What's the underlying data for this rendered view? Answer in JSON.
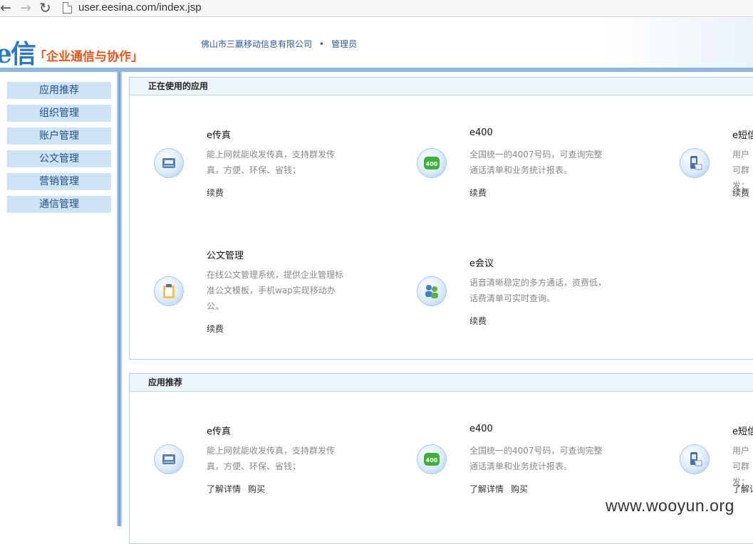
{
  "browser": {
    "back_icon": "arrow-left-icon",
    "forward_icon": "arrow-right-icon",
    "reload_icon": "reload-icon",
    "url": "user.eesina.com/index.jsp"
  },
  "header": {
    "logo_mark": "e信",
    "slogan": "「企业通信与协作」",
    "company": "佛山市三赢移动信息有限公司",
    "separator": "•",
    "role": "管理员"
  },
  "sidebar": {
    "items": [
      {
        "label": "应用推荐"
      },
      {
        "label": "组织管理"
      },
      {
        "label": "账户管理"
      },
      {
        "label": "公文管理"
      },
      {
        "label": "营销管理"
      },
      {
        "label": "通信管理"
      }
    ]
  },
  "in_use": {
    "title": "正在使用的应用",
    "apps": [
      {
        "name": "e传真",
        "icon": "fax-icon",
        "desc": "能上网就能收发传真，支持群发传真，方便、环保、省钱；",
        "link": "续费"
      },
      {
        "name": "e400",
        "icon": "badge-400-icon",
        "badge_text": "400",
        "desc": "全国统一的4007号码，可查询完整通话清单和业务统计报表。",
        "link": "续费"
      },
      {
        "name": "e短信",
        "icon": "sms-phone-icon",
        "desc": "用户可群发；",
        "link": "续费"
      },
      {
        "name": "公文管理",
        "icon": "clipboard-icon",
        "desc": "在线公文管理系统，提供企业管理标准公文模板，手机wap实现移动办公。",
        "link": "续费"
      },
      {
        "name": "e会议",
        "icon": "meeting-icon",
        "desc": "语音清晰稳定的多方通话，资费低，话费清单可实时查询。",
        "link": "续费"
      }
    ]
  },
  "recommended": {
    "title": "应用推荐",
    "apps": [
      {
        "name": "e传真",
        "icon": "fax-icon",
        "desc": "能上网就能收发传真，支持群发传真，方便、环保、省钱；",
        "details": "了解详情",
        "buy": "购买"
      },
      {
        "name": "e400",
        "icon": "badge-400-icon",
        "badge_text": "400",
        "desc": "全国统一的4007号码，可查询完整通话清单和业务统计报表。",
        "details": "了解详情",
        "buy": "购买"
      },
      {
        "name": "e短信",
        "icon": "sms-phone-icon",
        "desc": "用户可群发；",
        "details": "了解详"
      }
    ]
  },
  "watermark": "www.wooyun.org",
  "colors": {
    "brand_blue": "#2e78c2",
    "slogan_orange": "#e2561b",
    "menu_bg": "#cfe3f7",
    "badge_green": "#3fae3a"
  }
}
